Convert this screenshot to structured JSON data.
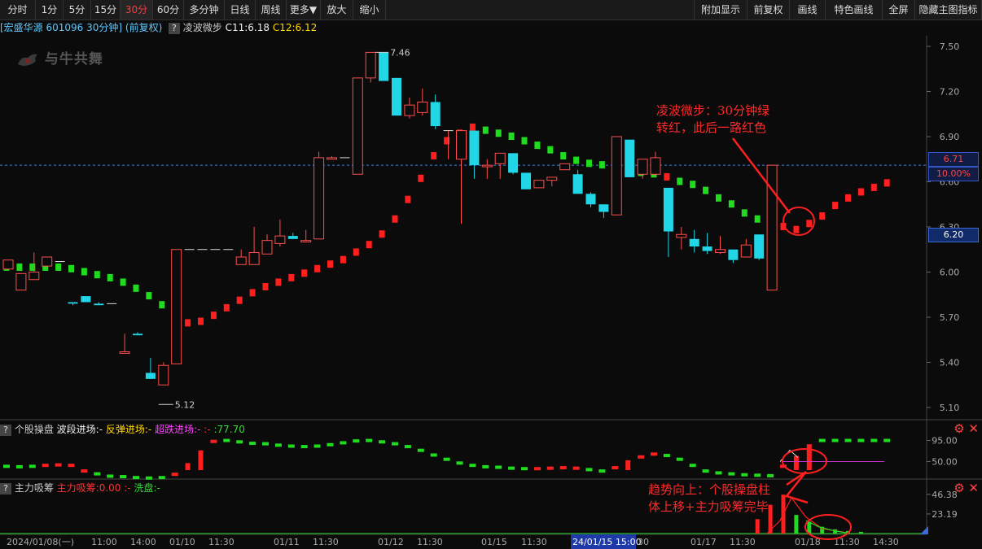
{
  "toolbar": {
    "left": [
      "分时",
      "1分",
      "5分",
      "15分",
      "30分",
      "60分",
      "多分钟",
      "日线",
      "周线",
      "更多▼",
      "放大",
      "缩小"
    ],
    "active": "30分",
    "right": [
      "附加显示",
      "前复权",
      "画线",
      "特色画线",
      "全屏",
      "隐藏主图指标"
    ]
  },
  "info": {
    "stock": "[宏盛华源 601096 30分钟]",
    "adjust": "(前复权)",
    "indicator": "凌波微步",
    "c11": "C11:6.18",
    "c12": "C12:6.12"
  },
  "logo_text": "与牛共舞",
  "price_axis": {
    "ticks": [
      "7.50",
      "7.20",
      "6.90",
      "6.60",
      "6.30",
      "6.00",
      "5.70",
      "5.40",
      "5.10"
    ],
    "current": "6.71",
    "current_pct": "10.00%",
    "cursor": "6.20",
    "min": 5.1,
    "max": 7.5
  },
  "chart_data": {
    "type": "candlestick",
    "high_label": "7.46",
    "low_label": "5.12",
    "candles": [
      [
        6.02,
        6.08,
        5.86,
        5.86
      ],
      [
        5.88,
        5.99,
        5.88,
        5.99
      ],
      [
        5.95,
        6.0,
        5.95,
        6.13
      ],
      [
        6.04,
        6.1,
        6.02,
        6.03
      ],
      [
        6.07,
        6.07,
        5.81,
        5.81
      ],
      [
        5.8,
        5.79,
        5.78,
        5.8
      ],
      [
        5.84,
        5.8,
        5.8,
        5.83
      ],
      [
        5.79,
        5.78,
        5.78,
        5.8
      ],
      [
        5.79,
        5.79,
        5.46,
        5.46
      ],
      [
        5.46,
        5.47,
        5.46,
        5.59
      ],
      [
        5.59,
        5.58,
        5.58,
        5.6
      ],
      [
        5.33,
        5.29,
        5.29,
        5.43
      ],
      [
        5.25,
        5.38,
        5.25,
        5.4
      ],
      [
        5.39,
        6.15,
        5.39,
        6.15
      ],
      [
        6.15,
        6.15,
        6.15,
        6.15
      ],
      [
        6.15,
        6.15,
        6.15,
        6.15
      ],
      [
        6.15,
        6.15,
        6.15,
        6.15
      ],
      [
        6.15,
        6.15,
        6.15,
        6.15
      ],
      [
        6.05,
        6.1,
        6.05,
        6.15
      ],
      [
        6.05,
        6.13,
        6.05,
        6.3
      ],
      [
        6.12,
        6.21,
        6.12,
        6.25
      ],
      [
        6.19,
        6.24,
        6.17,
        6.35
      ],
      [
        6.24,
        6.22,
        6.22,
        6.26
      ],
      [
        6.2,
        6.21,
        6.2,
        6.28
      ],
      [
        6.22,
        6.76,
        6.22,
        6.8
      ],
      [
        6.75,
        6.76,
        6.75,
        6.77
      ],
      [
        6.76,
        6.76,
        6.76,
        6.76
      ],
      [
        6.65,
        7.29,
        6.65,
        7.29
      ],
      [
        7.29,
        7.46,
        7.26,
        7.46
      ],
      [
        7.46,
        7.27,
        7.27,
        7.46
      ],
      [
        7.29,
        7.04,
        7.04,
        7.29
      ],
      [
        7.04,
        7.11,
        7.02,
        7.16
      ],
      [
        7.06,
        7.13,
        7.04,
        7.22
      ],
      [
        7.13,
        6.97,
        6.95,
        7.18
      ],
      [
        6.94,
        6.94,
        6.75,
        6.94
      ],
      [
        6.75,
        6.94,
        6.32,
        6.94
      ],
      [
        6.94,
        6.71,
        6.62,
        6.94
      ],
      [
        6.7,
        6.71,
        6.62,
        6.75
      ],
      [
        6.72,
        6.79,
        6.62,
        6.79
      ],
      [
        6.79,
        6.66,
        6.65,
        6.79
      ],
      [
        6.66,
        6.55,
        6.55,
        6.66
      ],
      [
        6.56,
        6.61,
        6.56,
        6.61
      ],
      [
        6.61,
        6.63,
        6.57,
        6.63
      ],
      [
        6.68,
        6.72,
        6.68,
        6.72
      ],
      [
        6.65,
        6.52,
        6.52,
        6.68
      ],
      [
        6.52,
        6.45,
        6.43,
        6.53
      ],
      [
        6.45,
        6.4,
        6.36,
        6.45
      ],
      [
        6.38,
        6.9,
        6.38,
        6.9
      ],
      [
        6.88,
        6.63,
        6.63,
        6.88
      ],
      [
        6.65,
        6.75,
        6.62,
        6.75
      ],
      [
        6.65,
        6.76,
        6.64,
        6.8
      ],
      [
        6.56,
        6.27,
        6.1,
        6.56
      ],
      [
        6.23,
        6.25,
        6.15,
        6.3
      ],
      [
        6.22,
        6.17,
        6.13,
        6.28
      ],
      [
        6.17,
        6.14,
        6.12,
        6.26
      ],
      [
        6.13,
        6.15,
        6.12,
        6.24
      ],
      [
        6.15,
        6.08,
        6.06,
        6.15
      ],
      [
        6.1,
        6.18,
        6.1,
        6.22
      ],
      [
        6.25,
        6.09,
        6.08,
        6.25
      ],
      [
        5.88,
        6.71,
        5.88,
        6.71
      ]
    ],
    "ma_dots": [
      [
        6.03,
        "g"
      ],
      [
        6.03,
        "g"
      ],
      [
        6.03,
        "g"
      ],
      [
        6.03,
        "g"
      ],
      [
        6.03,
        "g"
      ],
      [
        6.02,
        "g"
      ],
      [
        6.0,
        "g"
      ],
      [
        5.98,
        "g"
      ],
      [
        5.96,
        "g"
      ],
      [
        5.93,
        "g"
      ],
      [
        5.89,
        "g"
      ],
      [
        5.84,
        "g"
      ],
      [
        5.78,
        "g"
      ],
      [
        5.72,
        "g"
      ],
      [
        5.66,
        "r"
      ],
      [
        5.67,
        "r"
      ],
      [
        5.71,
        "r"
      ],
      [
        5.76,
        "r"
      ],
      [
        5.81,
        "r"
      ],
      [
        5.86,
        "r"
      ],
      [
        5.9,
        "r"
      ],
      [
        5.93,
        "r"
      ],
      [
        5.96,
        "r"
      ],
      [
        5.99,
        "r"
      ],
      [
        6.02,
        "r"
      ],
      [
        6.05,
        "r"
      ],
      [
        6.08,
        "r"
      ],
      [
        6.13,
        "r"
      ],
      [
        6.18,
        "r"
      ],
      [
        6.25,
        "r"
      ],
      [
        6.35,
        "r"
      ],
      [
        6.48,
        "r"
      ],
      [
        6.62,
        "r"
      ],
      [
        6.77,
        "r"
      ],
      [
        6.87,
        "r"
      ],
      [
        6.92,
        "r"
      ],
      [
        6.96,
        "r"
      ],
      [
        6.94,
        "g"
      ],
      [
        6.92,
        "g"
      ],
      [
        6.9,
        "g"
      ],
      [
        6.87,
        "g"
      ],
      [
        6.84,
        "g"
      ],
      [
        6.81,
        "g"
      ],
      [
        6.77,
        "g"
      ],
      [
        6.74,
        "g"
      ],
      [
        6.72,
        "g"
      ],
      [
        6.71,
        "g"
      ],
      [
        6.68,
        "g"
      ],
      [
        6.67,
        "g"
      ],
      [
        6.66,
        "g"
      ],
      [
        6.65,
        "g"
      ],
      [
        6.63,
        "r"
      ],
      [
        6.6,
        "g"
      ],
      [
        6.58,
        "g"
      ],
      [
        6.54,
        "g"
      ],
      [
        6.49,
        "g"
      ],
      [
        6.45,
        "g"
      ],
      [
        6.39,
        "g"
      ],
      [
        6.35,
        "g"
      ],
      [
        6.3,
        "g"
      ],
      [
        6.3,
        "r"
      ],
      [
        6.28,
        "r"
      ],
      [
        6.32,
        "r"
      ],
      [
        6.37,
        "r"
      ],
      [
        6.44,
        "r"
      ],
      [
        6.49,
        "r"
      ],
      [
        6.53,
        "r"
      ],
      [
        6.56,
        "r"
      ],
      [
        6.59,
        "r"
      ]
    ]
  },
  "annotations": {
    "main": [
      "凌波微步：30分钟绿",
      "转红，此后一路红色"
    ],
    "sub": [
      "趋势向上：个股操盘柱",
      "体上移+主力吸筹完毕"
    ]
  },
  "ind1": {
    "name": "个股操盘",
    "l1": "波段进场:-",
    "l2": "反弹进场:-",
    "l3": "超跌进场:-",
    "l4": ":77.70",
    "ticks": [
      "95.00",
      "50.00"
    ],
    "min": 25,
    "max": 115,
    "dots": [
      [
        40,
        "g"
      ],
      [
        39,
        "g"
      ],
      [
        40,
        "g"
      ],
      [
        42,
        "r"
      ],
      [
        43,
        "r"
      ],
      [
        42,
        "r"
      ],
      [
        30,
        "r"
      ],
      [
        24,
        "g"
      ],
      [
        19,
        "g"
      ],
      [
        18,
        "g"
      ],
      [
        16,
        "g"
      ],
      [
        15,
        "g"
      ],
      [
        16,
        "g"
      ],
      [
        23,
        "r"
      ],
      [
        40,
        "r"
      ],
      [
        67,
        "r"
      ],
      [
        93,
        "r"
      ],
      [
        95,
        "g"
      ],
      [
        92,
        "g"
      ],
      [
        89,
        "g"
      ],
      [
        88,
        "g"
      ],
      [
        85,
        "g"
      ],
      [
        83,
        "g"
      ],
      [
        82,
        "g"
      ],
      [
        83,
        "g"
      ],
      [
        86,
        "g"
      ],
      [
        90,
        "g"
      ],
      [
        94,
        "g"
      ],
      [
        95,
        "g"
      ],
      [
        92,
        "g"
      ],
      [
        88,
        "g"
      ],
      [
        82,
        "g"
      ],
      [
        74,
        "g"
      ],
      [
        64,
        "g"
      ],
      [
        55,
        "g"
      ],
      [
        47,
        "g"
      ],
      [
        42,
        "g"
      ],
      [
        39,
        "g"
      ],
      [
        38,
        "g"
      ],
      [
        36,
        "g"
      ],
      [
        35,
        "g"
      ],
      [
        35,
        "r"
      ],
      [
        36,
        "r"
      ],
      [
        37,
        "r"
      ],
      [
        36,
        "r"
      ],
      [
        33,
        "g"
      ],
      [
        30,
        "g"
      ],
      [
        37,
        "r"
      ],
      [
        46,
        "r"
      ],
      [
        60,
        "r"
      ],
      [
        66,
        "r"
      ],
      [
        63,
        "g"
      ],
      [
        55,
        "g"
      ],
      [
        42,
        "g"
      ],
      [
        30,
        "g"
      ],
      [
        26,
        "g"
      ],
      [
        24,
        "g"
      ],
      [
        22,
        "g"
      ],
      [
        21,
        "g"
      ],
      [
        20,
        "g"
      ],
      [
        40,
        "r"
      ],
      [
        55,
        "r"
      ],
      [
        80,
        "r"
      ],
      [
        95,
        "g"
      ],
      [
        95,
        "g"
      ],
      [
        95,
        "g"
      ],
      [
        95,
        "g"
      ],
      [
        95,
        "g"
      ],
      [
        95,
        "g"
      ]
    ]
  },
  "ind2": {
    "name": "主力吸筹",
    "l1": "主力吸筹:0.00",
    "l2": "洗盘:-",
    "ticks": [
      "46.38",
      "23.19"
    ],
    "max": 50,
    "bars": [
      [
        58,
        17,
        "r"
      ],
      [
        59,
        34,
        "r"
      ],
      [
        60,
        46,
        "r"
      ],
      [
        61,
        22,
        "g"
      ],
      [
        62,
        14,
        "g"
      ],
      [
        63,
        8,
        "g"
      ],
      [
        64,
        5,
        "g"
      ],
      [
        65,
        3,
        "g"
      ],
      [
        66,
        2,
        "g"
      ]
    ]
  },
  "time_axis": [
    "2024/01/08(一)",
    "11:00",
    "14:00",
    "01/10",
    "11:30",
    "01/11",
    "11:30",
    "01/12",
    "11:30",
    "01/15",
    "11:30",
    "24/01/15 15:00",
    "30",
    "01/17",
    "11:30",
    "01/18",
    "11:30",
    "14:30"
  ]
}
